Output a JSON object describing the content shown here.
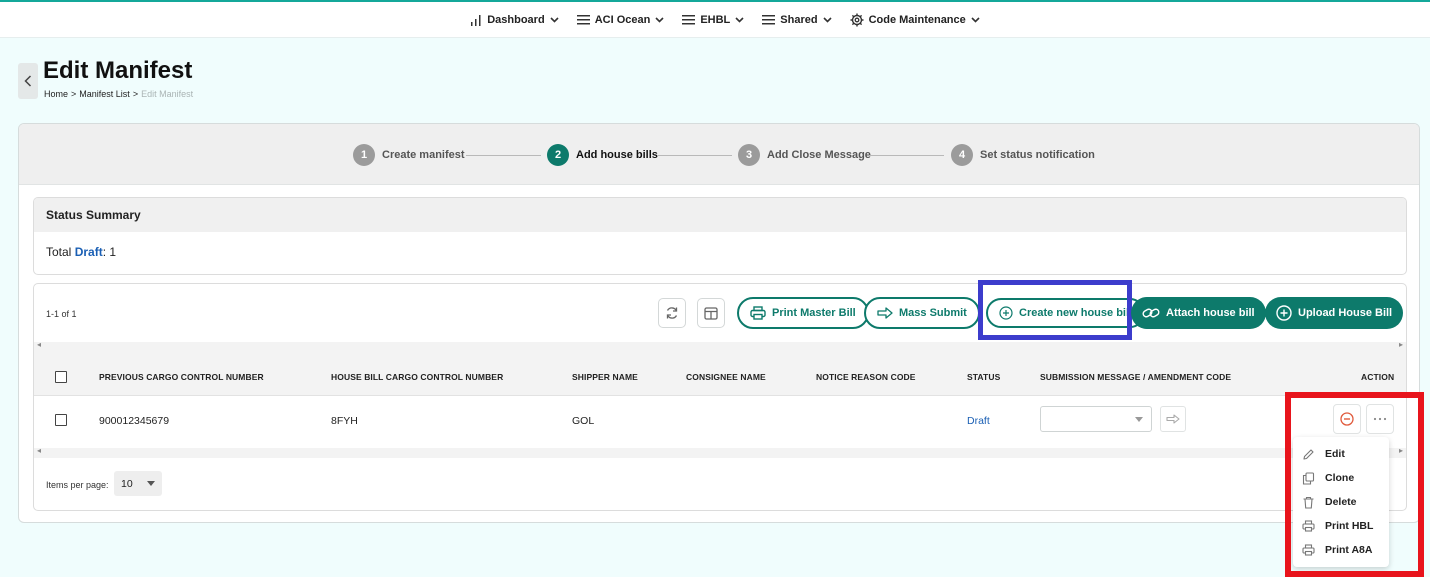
{
  "nav": {
    "items": [
      {
        "label": "Dashboard",
        "icon": "bar-chart-icon"
      },
      {
        "label": "ACI Ocean",
        "icon": "menu-icon"
      },
      {
        "label": "EHBL",
        "icon": "menu-icon"
      },
      {
        "label": "Shared",
        "icon": "menu-icon"
      },
      {
        "label": "Code Maintenance",
        "icon": "gear-icon"
      }
    ]
  },
  "header": {
    "title": "Edit Manifest",
    "breadcrumb": [
      "Home",
      ">",
      "Manifest List",
      ">",
      "Edit Manifest"
    ]
  },
  "stepper": {
    "steps": [
      {
        "num": "1",
        "label": "Create manifest",
        "active": false
      },
      {
        "num": "2",
        "label": "Add house bills",
        "active": true
      },
      {
        "num": "3",
        "label": "Add Close Message",
        "active": false
      },
      {
        "num": "4",
        "label": "Set status notification",
        "active": false
      }
    ]
  },
  "summary": {
    "title": "Status Summary",
    "total_label": "Total",
    "draft_label": "Draft",
    "count": ": 1"
  },
  "toolbar": {
    "range": "1-1 of 1",
    "print_master_bill": "Print Master Bill",
    "mass_submit": "Mass Submit",
    "create_new_house_bill": "Create new house bill",
    "attach_house_bill": "Attach house bill",
    "upload_house_bill": "Upload House Bill"
  },
  "table": {
    "columns": [
      "PREVIOUS CARGO CONTROL NUMBER",
      "HOUSE BILL CARGO CONTROL NUMBER",
      "SHIPPER NAME",
      "CONSIGNEE NAME",
      "NOTICE REASON CODE",
      "STATUS",
      "SUBMISSION MESSAGE / AMENDMENT CODE",
      "ACTION"
    ],
    "rows": [
      {
        "previous_ccn": "900012345679",
        "house_bill_ccn": "8FYH",
        "shipper": "GOL",
        "consignee": "",
        "notice_reason": "",
        "status": "Draft",
        "submission_message": ""
      }
    ]
  },
  "pager": {
    "label": "Items per page:",
    "value": "10"
  },
  "action_menu": {
    "items": [
      {
        "label": "Edit",
        "icon": "pencil-icon"
      },
      {
        "label": "Clone",
        "icon": "copy-icon"
      },
      {
        "label": "Delete",
        "icon": "trash-icon"
      },
      {
        "label": "Print HBL",
        "icon": "printer-icon"
      },
      {
        "label": "Print A8A",
        "icon": "printer-icon"
      }
    ]
  },
  "colors": {
    "accent": "#0d7a6b",
    "link": "#1a5fb4",
    "highlight_blue": "#3c3ccc",
    "highlight_red": "#e8141c",
    "background": "#f0fdfd"
  }
}
